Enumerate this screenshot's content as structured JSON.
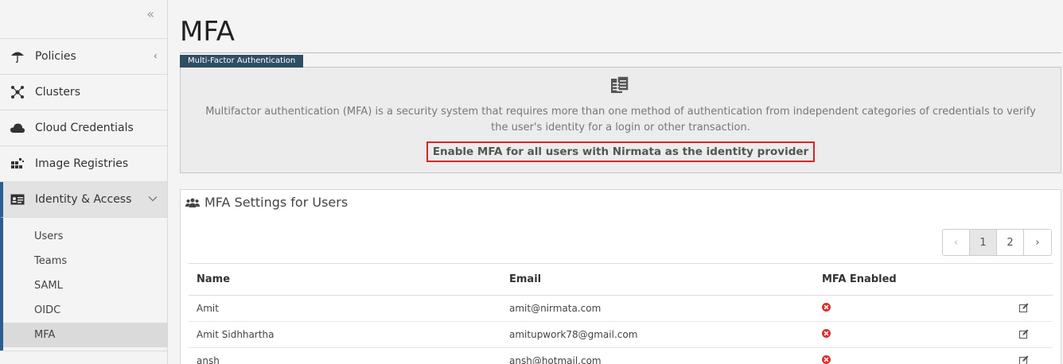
{
  "sidebar": {
    "collapse_glyph": "«",
    "items": [
      {
        "label": "Policies",
        "icon": "umbrella-icon",
        "chevron": "‹"
      },
      {
        "label": "Clusters",
        "icon": "cluster-icon"
      },
      {
        "label": "Cloud Credentials",
        "icon": "cloud-icon"
      },
      {
        "label": "Image Registries",
        "icon": "registry-icon"
      },
      {
        "label": "Identity & Access",
        "icon": "id-card-icon",
        "chevron": "⌄"
      }
    ],
    "subitems": [
      "Users",
      "Teams",
      "SAML",
      "OIDC",
      "MFA"
    ],
    "selected_subitem": "MFA"
  },
  "page": {
    "title": "MFA",
    "tag": "Multi-Factor Authentication",
    "description": "Multifactor authentication (MFA) is a security system that requires more than one method of authentication from independent categories of credentials to verify the user's identity for a login or other transaction.",
    "enable_button": "Enable MFA for all users with Nirmata as the identity provider"
  },
  "panel": {
    "title": "MFA Settings for Users",
    "pager": {
      "prev": "‹",
      "pages": [
        "1",
        "2"
      ],
      "next": "›",
      "current": "1"
    },
    "columns": [
      "Name",
      "Email",
      "MFA Enabled"
    ],
    "rows": [
      {
        "name": "Amit",
        "email": "amit@nirmata.com",
        "mfa_enabled": false
      },
      {
        "name": "Amit Sidhhartha",
        "email": "amitupwork78@gmail.com",
        "mfa_enabled": false
      },
      {
        "name": "ansh",
        "email": "ansh@hotmail.com",
        "mfa_enabled": false
      }
    ]
  },
  "colors": {
    "accent": "#2c5d93",
    "tag_bg": "#2e4e64",
    "highlight": "#dd2222",
    "disabled_red": "#d9302c"
  }
}
